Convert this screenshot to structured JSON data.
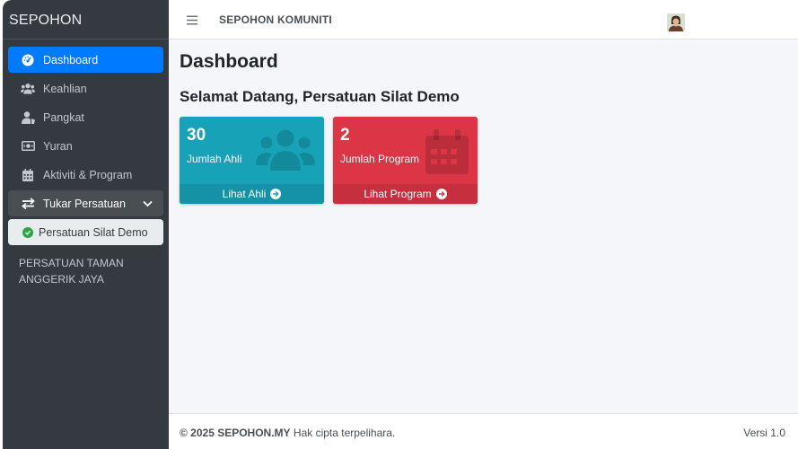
{
  "brand": "SEPOHON",
  "sidebar": {
    "items": [
      {
        "label": "Dashboard"
      },
      {
        "label": "Keahlian"
      },
      {
        "label": "Pangkat"
      },
      {
        "label": "Yuran"
      },
      {
        "label": "Aktiviti & Program"
      },
      {
        "label": "Tukar Persatuan"
      }
    ],
    "sub_item": "Persatuan Silat Demo",
    "org_name": "PERSATUAN TAMAN ANGGERIK JAYA"
  },
  "topbar": {
    "title": "SEPOHON KOMUNITI"
  },
  "main": {
    "page_title": "Dashboard",
    "welcome": "Selamat Datang, Persatuan Silat Demo",
    "cards": [
      {
        "value": "30",
        "label": "Jumlah Ahli",
        "link": "Lihat Ahli",
        "color": "#17a2b8"
      },
      {
        "value": "2",
        "label": "Jumlah Program",
        "link": "Lihat Program",
        "color": "#dc3545"
      }
    ]
  },
  "footer": {
    "copyright_strong": "© 2025 SEPOHON.MY",
    "copyright_rest": " Hak cipta terpelihara.",
    "version": "Versi 1.0"
  },
  "colors": {
    "sidebar": "#343a40",
    "active": "#007bff",
    "content_bg": "#f4f6f9"
  }
}
